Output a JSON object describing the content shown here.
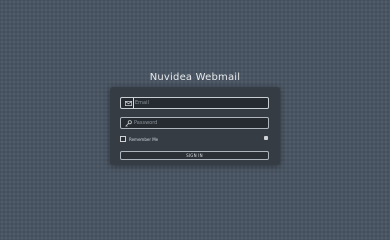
{
  "app": {
    "title": "Nuvidea Webmail"
  },
  "login": {
    "username": {
      "placeholder": "Email",
      "value": "",
      "icon": "envelope-icon"
    },
    "password": {
      "placeholder": "Password",
      "value": "",
      "icon": "key-icon"
    },
    "remember_me": {
      "label": "Remember Me",
      "checked": false
    },
    "help_icon": "help-icon",
    "submit_label": "SIGN IN"
  },
  "colors": {
    "background": "#4a5563",
    "panel": "#353c44",
    "field_border": "#aeb5bc",
    "text": "#e6e9ec"
  }
}
